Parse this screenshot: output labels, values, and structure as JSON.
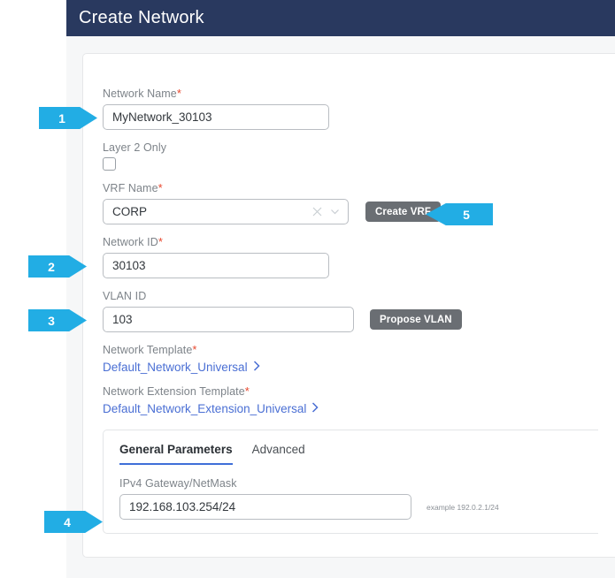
{
  "dialog": {
    "title": "Create Network"
  },
  "form": {
    "network_name": {
      "label": "Network Name",
      "required": true,
      "value": "MyNetwork_30103"
    },
    "layer2_only": {
      "label": "Layer 2 Only",
      "checked": false
    },
    "vrf_name": {
      "label": "VRF Name",
      "required": true,
      "value": "CORP",
      "clear_icon": "close-icon",
      "dropdown_icon": "chevron-down-icon",
      "create_button": "Create VRF"
    },
    "network_id": {
      "label": "Network ID",
      "required": true,
      "value": "30103"
    },
    "vlan_id": {
      "label": "VLAN ID",
      "required": false,
      "value": "103",
      "propose_button": "Propose VLAN"
    },
    "network_template": {
      "label": "Network Template",
      "required": true,
      "value": "Default_Network_Universal",
      "chevron_icon": "chevron-right-icon"
    },
    "network_extension_template": {
      "label": "Network Extension Template",
      "required": true,
      "value": "Default_Network_Extension_Universal",
      "chevron_icon": "chevron-right-icon"
    }
  },
  "tabs": [
    {
      "label": "General Parameters",
      "active": true
    },
    {
      "label": "Advanced",
      "active": false
    }
  ],
  "general_parameters": {
    "gateway": {
      "label": "IPv4 Gateway/NetMask",
      "value": "192.168.103.254/24",
      "example": "example 192.0.2.1/24"
    }
  },
  "callouts": [
    {
      "number": "1",
      "direction": "right"
    },
    {
      "number": "2",
      "direction": "right"
    },
    {
      "number": "3",
      "direction": "right"
    },
    {
      "number": "4",
      "direction": "right"
    },
    {
      "number": "5",
      "direction": "left"
    }
  ],
  "colors": {
    "header_bg": "#29395f",
    "callout_blue": "#22ade4",
    "link_blue": "#4a6fd4",
    "required_red": "#e8482e",
    "button_gray": "#6a6e73",
    "tab_underline": "#3f6fd8"
  }
}
